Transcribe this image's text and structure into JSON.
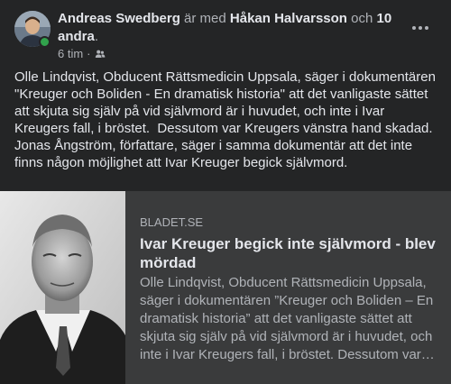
{
  "post": {
    "author": "Andreas Swedberg",
    "with_text": "är med",
    "tagged_person": "Håkan Halvarsson",
    "and_text": "och",
    "others": "10 andra",
    "period": ".",
    "time": "6 tim",
    "separator": "·",
    "audience_icon": "friends-icon",
    "text": "Olle Lindqvist, Obducent Rättsmedicin Uppsala, säger i dokumentären \"Kreuger och Boliden - En dramatisk historia\" att det vanligaste sättet att skjuta sig själv på vid självmord är i huvudet, och inte i Ivar Kreugers fall, i bröstet.  Dessutom var Kreugers vänstra hand skadad. Jonas Ångström, författare, säger i samma dokumentär att det inte finns någon möjlighet att Ivar Kreuger begick självmord."
  },
  "link_card": {
    "domain": "BLADET.SE",
    "title": "Ivar Kreuger begick inte självmord - blev mördad",
    "description": "Olle Lindqvist, Obducent Rättsmedicin Uppsala, säger i dokumentären ”Kreuger och Boliden – En dramatisk historia” att det vanligaste sättet att skjuta sig själv på vid självmord är i huvudet, och inte i Ivar Kreugers fall, i bröstet. Dessutom var Kreugers vänstra hand skadad."
  },
  "colors": {
    "background": "#242526",
    "card_background": "#3a3b3c",
    "primary_text": "#e4e6eb",
    "secondary_text": "#b0b3b8",
    "online": "#31a24c"
  }
}
